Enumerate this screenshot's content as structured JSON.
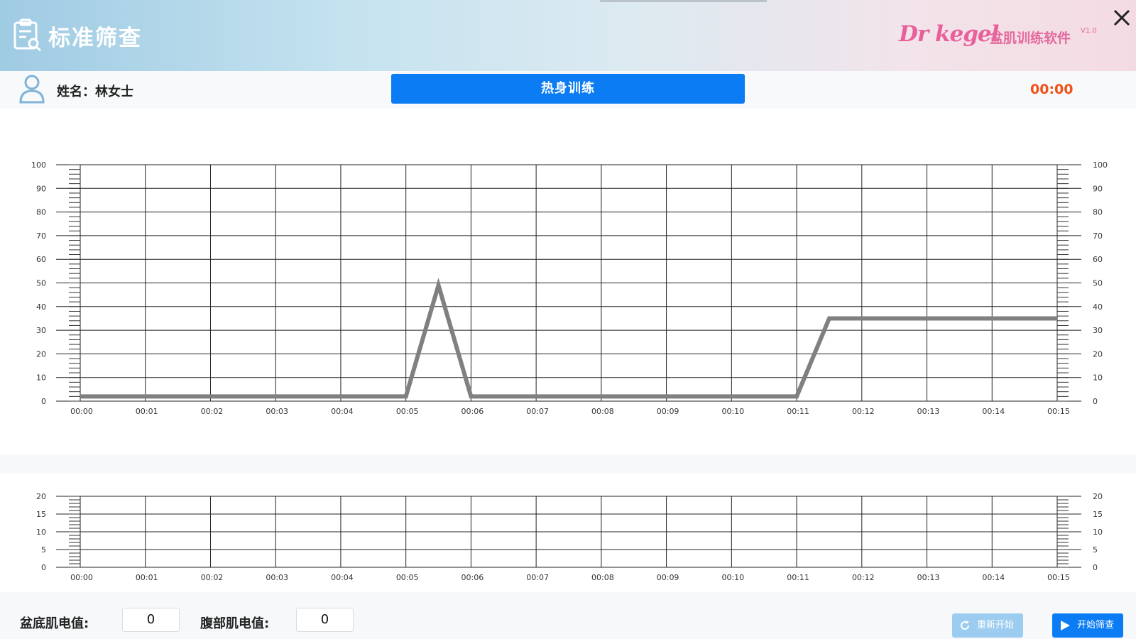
{
  "header": {
    "title": "标准筛查",
    "brand": "Dr kegel",
    "brand_sub": "盆肌训练软件",
    "version": "V1.0"
  },
  "info": {
    "name": "姓名：林女士",
    "phase": "热身训练",
    "timer": "00:00"
  },
  "footer": {
    "pelvic_label": "盆底肌电值:",
    "pelvic_value": "0",
    "abdominal_label": "腹部肌电值:",
    "abdominal_value": "0",
    "restart_label": "重新开始",
    "start_label": "开始筛查"
  },
  "colors": {
    "accent": "#0b7cf4",
    "timer": "#f05318",
    "brand": "#e8609a",
    "series": "#808080"
  },
  "icons": [
    "screening-icon",
    "user-icon",
    "close-icon",
    "refresh-icon",
    "play-icon"
  ],
  "chart_data": [
    {
      "type": "line",
      "title": "",
      "xlabel": "",
      "ylabel": "",
      "categories": [
        "00:00",
        "00:01",
        "00:02",
        "00:03",
        "00:04",
        "00:05",
        "00:06",
        "00:07",
        "00:08",
        "00:09",
        "00:10",
        "00:11",
        "00:12",
        "00:13",
        "00:14",
        "00:15"
      ],
      "x_seconds_range": [
        0,
        15
      ],
      "ylim": [
        0,
        100
      ],
      "yticks": [
        0,
        10,
        20,
        30,
        40,
        50,
        60,
        70,
        80,
        90,
        100
      ],
      "grid": true,
      "y_axis_both_sides": true,
      "series": [
        {
          "points": [
            [
              0,
              2
            ],
            [
              5,
              2
            ],
            [
              5.5,
              49
            ],
            [
              6,
              2
            ],
            [
              11,
              2
            ],
            [
              11.5,
              35
            ],
            [
              15,
              35
            ]
          ]
        }
      ]
    },
    {
      "type": "line",
      "title": "",
      "xlabel": "",
      "ylabel": "",
      "categories": [
        "00:00",
        "00:01",
        "00:02",
        "00:03",
        "00:04",
        "00:05",
        "00:06",
        "00:07",
        "00:08",
        "00:09",
        "00:10",
        "00:11",
        "00:12",
        "00:13",
        "00:14",
        "00:15"
      ],
      "x_seconds_range": [
        0,
        15
      ],
      "ylim": [
        0,
        20
      ],
      "yticks": [
        0,
        5,
        10,
        15,
        20
      ],
      "grid": true,
      "y_axis_both_sides": true,
      "series": []
    }
  ]
}
